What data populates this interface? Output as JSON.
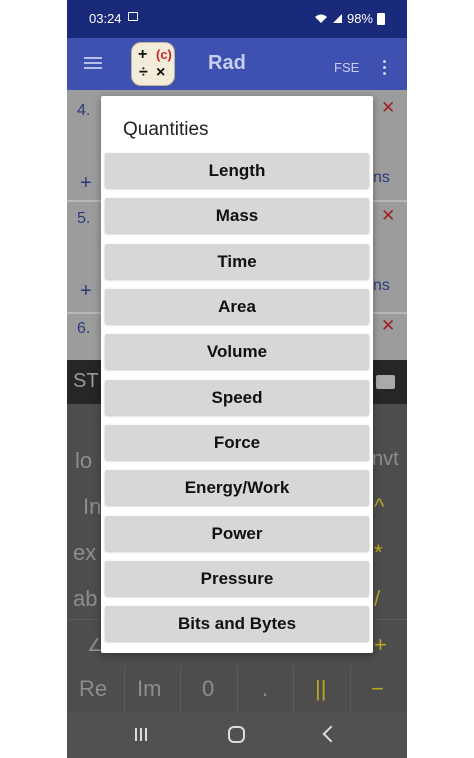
{
  "status_bar": {
    "time": "03:24",
    "battery": "98%"
  },
  "app_bar": {
    "title": "Rad",
    "mode": "FSE"
  },
  "background_list": {
    "items": [
      {
        "number": "4."
      },
      {
        "number": "5."
      },
      {
        "number": "6."
      }
    ],
    "partial_label": "ns"
  },
  "keypad": {
    "stat_label": "ST",
    "keys": {
      "lo": "lo",
      "ln": "In",
      "ex": "ex",
      "ab": "ab",
      "cnvt": "nvt",
      "pow": "^",
      "mul": "*",
      "div": "/",
      "plus": "+",
      "re": "Re",
      "im": "Im",
      "zero": "0",
      "dot": ".",
      "parallel": "||",
      "minus": "−"
    }
  },
  "dialog": {
    "title": "Quantities",
    "options": [
      "Length",
      "Mass",
      "Time",
      "Area",
      "Volume",
      "Speed",
      "Force",
      "Energy/Work",
      "Power",
      "Pressure",
      "Bits and Bytes"
    ]
  },
  "colors": {
    "app_bar": "#3e51b0",
    "status_bar": "#1a2a7a",
    "dialog_button": "#d7d7d7"
  }
}
